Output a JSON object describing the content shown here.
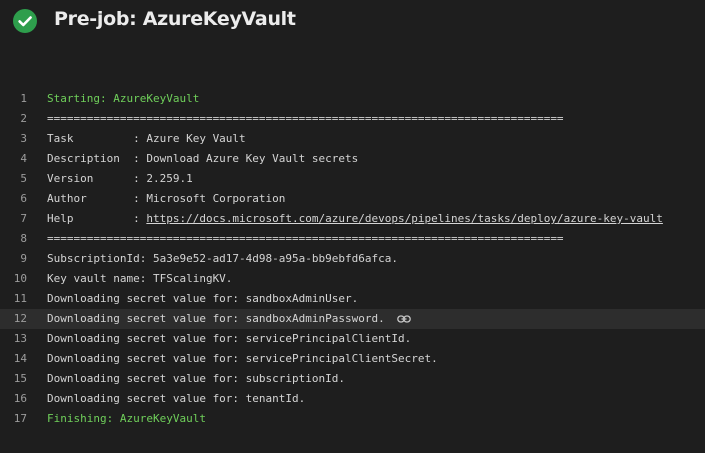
{
  "header": {
    "title": "Pre-job: AzureKeyVault",
    "status_icon": "check-circle-icon",
    "status_color": "#2e9e4c"
  },
  "log": {
    "lines": [
      {
        "num": "1",
        "text": "Starting: AzureKeyVault"
      },
      {
        "num": "2",
        "text": "=============================================================================="
      },
      {
        "num": "3",
        "text": "Task         : Azure Key Vault"
      },
      {
        "num": "4",
        "text": "Description  : Download Azure Key Vault secrets"
      },
      {
        "num": "5",
        "text": "Version      : 2.259.1"
      },
      {
        "num": "6",
        "text": "Author       : Microsoft Corporation"
      },
      {
        "num": "7",
        "prefix": "Help         : ",
        "link": "https://docs.microsoft.com/azure/devops/pipelines/tasks/deploy/azure-key-vault"
      },
      {
        "num": "8",
        "text": "=============================================================================="
      },
      {
        "num": "9",
        "text": "SubscriptionId: 5a3e9e52-ad17-4d98-a95a-bb9ebfd6afca."
      },
      {
        "num": "10",
        "text": "Key vault name: TFScalingKV."
      },
      {
        "num": "11",
        "text": "Downloading secret value for: sandboxAdminUser."
      },
      {
        "num": "12",
        "text": "Downloading secret value for: sandboxAdminPassword."
      },
      {
        "num": "13",
        "text": "Downloading secret value for: servicePrincipalClientId."
      },
      {
        "num": "14",
        "text": "Downloading secret value for: servicePrincipalClientSecret."
      },
      {
        "num": "15",
        "text": "Downloading secret value for: subscriptionId."
      },
      {
        "num": "16",
        "text": "Downloading secret value for: tenantId."
      },
      {
        "num": "17",
        "text": "Finishing: AzureKeyVault"
      }
    ],
    "colors": {
      "start_finish": "#6fcf5a",
      "text": "#d4d4d4",
      "line_number": "#9d9d9d",
      "highlight_row": "#2d2d2d"
    },
    "row_link_icon": "link-icon"
  }
}
